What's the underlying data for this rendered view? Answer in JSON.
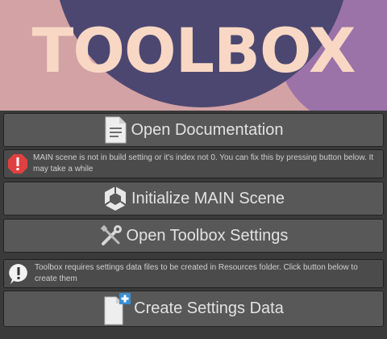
{
  "banner": {
    "title": "TOOLBOX",
    "colors": {
      "left": "#d3a2a5",
      "circle": "#4c4770",
      "right": "#9b73a8",
      "text": "#f8d8c4"
    }
  },
  "buttons": {
    "open_documentation": {
      "label": "Open Documentation",
      "icon": "document-icon"
    },
    "initialize_main_scene": {
      "label": "Initialize MAIN Scene",
      "icon": "unity-cube-icon"
    },
    "open_toolbox_settings": {
      "label": "Open Toolbox Settings",
      "icon": "tools-icon"
    },
    "create_settings_data": {
      "label": "Create Settings Data",
      "icon": "new-file-icon"
    }
  },
  "messages": {
    "main_scene_error": {
      "text": "MAIN scene is not in build setting or it's index not 0. You can fix this by pressing button below. It may take a while",
      "icon": "error-icon",
      "icon_color": "#e04040"
    },
    "settings_info": {
      "text": "Toolbox requires settings data files to be created in Resources folder. Click button below to create them",
      "icon": "info-icon"
    }
  }
}
